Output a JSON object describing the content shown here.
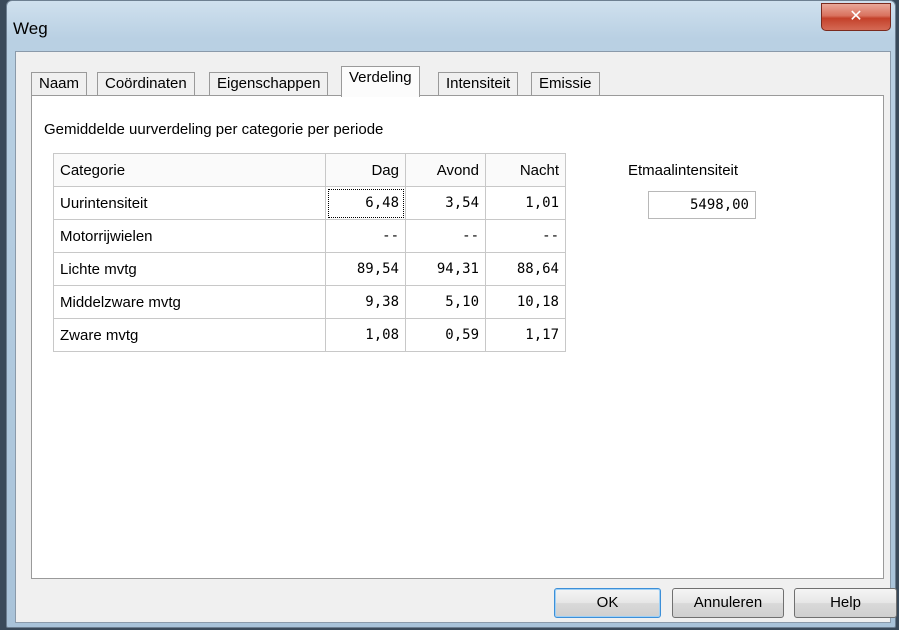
{
  "window": {
    "title": "Weg",
    "close_glyph": "✕"
  },
  "tabs": [
    {
      "label": "Naam"
    },
    {
      "label": "Coördinaten"
    },
    {
      "label": "Eigenschappen"
    },
    {
      "label": "Verdeling",
      "active": true
    },
    {
      "label": "Intensiteit"
    },
    {
      "label": "Emissie"
    }
  ],
  "panel": {
    "heading": "Gemiddelde uurverdeling per categorie per periode",
    "table": {
      "headers": [
        "Categorie",
        "Dag",
        "Avond",
        "Nacht"
      ],
      "rows": [
        [
          "Uurintensiteit",
          "6,48",
          "3,54",
          "1,01"
        ],
        [
          "Motorrijwielen",
          "--",
          "--",
          "--"
        ],
        [
          "Lichte mvtg",
          "89,54",
          "94,31",
          "88,64"
        ],
        [
          "Middelzware mvtg",
          "9,38",
          "5,10",
          "10,18"
        ],
        [
          "Zware mvtg",
          "1,08",
          "0,59",
          "1,17"
        ]
      ]
    },
    "etmaal": {
      "label": "Etmaalintensiteit",
      "value": "5498,00"
    }
  },
  "buttons": {
    "ok": "OK",
    "cancel": "Annuleren",
    "help": "Help"
  }
}
